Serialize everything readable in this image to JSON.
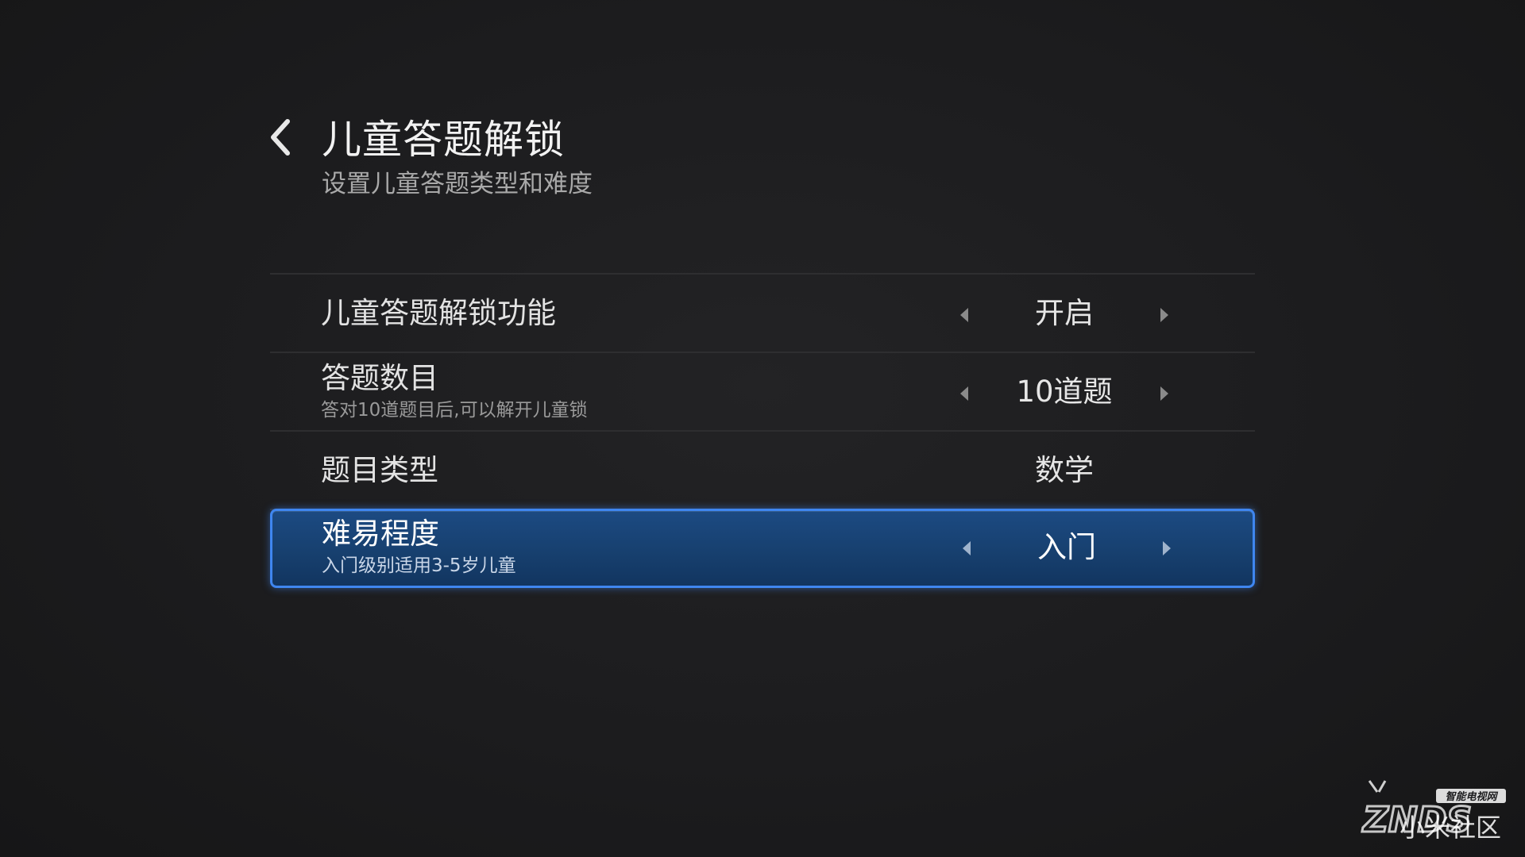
{
  "header": {
    "title": "儿童答题解锁",
    "subtitle": "设置儿童答题类型和难度",
    "back_icon": "chevron-left-icon"
  },
  "settings": [
    {
      "label": "儿童答题解锁功能",
      "description": "",
      "value": "开启",
      "has_arrows": true,
      "focused": false
    },
    {
      "label": "答题数目",
      "description": "答对10道题目后,可以解开儿童锁",
      "value": "10道题",
      "has_arrows": true,
      "focused": false
    },
    {
      "label": "题目类型",
      "description": "",
      "value": "数学",
      "has_arrows": false,
      "focused": false
    },
    {
      "label": "难易程度",
      "description": "入门级别适用3-5岁儿童",
      "value": "入门",
      "has_arrows": true,
      "focused": true
    }
  ],
  "colors": {
    "background": "#1c1c1e",
    "focus_border": "#3f86f0",
    "focus_fill": "#17406f",
    "divider": "#2e2e30"
  },
  "watermark": {
    "logo_text": "ZNDS",
    "logo_subtext": "智能电视网",
    "caption": "小米社区"
  }
}
